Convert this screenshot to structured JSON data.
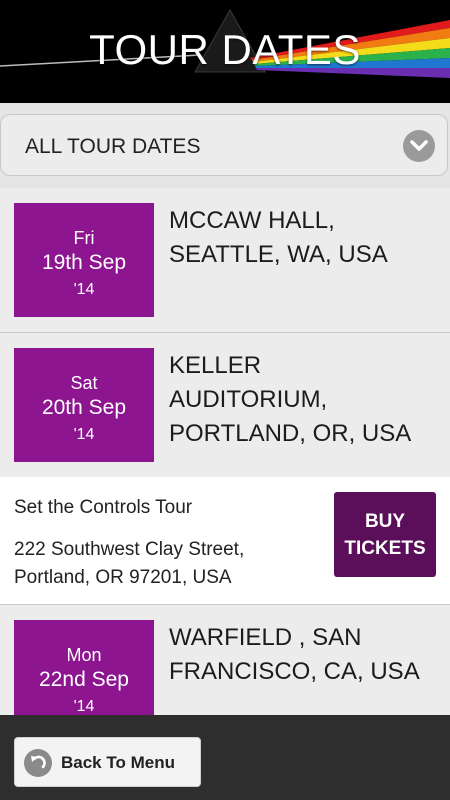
{
  "header": {
    "title": "TOUR DATES"
  },
  "filter": {
    "selected": "ALL TOUR DATES"
  },
  "events": [
    {
      "day": "Fri",
      "date": "19th Sep",
      "year": "'14",
      "venue": [
        "MCCAW HALL,",
        "SEATTLE, WA, USA"
      ]
    },
    {
      "day": "Sat",
      "date": "20th Sep",
      "year": "'14",
      "venue": [
        "KELLER",
        "AUDITORIUM,",
        "PORTLAND, OR, USA"
      ]
    },
    {
      "day": "Mon",
      "date": "22nd Sep",
      "year": "'14",
      "venue": [
        "WARFIELD , SAN",
        "FRANCISCO, CA, USA"
      ]
    }
  ],
  "details": {
    "tour_name": "Set the Controls Tour",
    "address_line1": "222 Southwest Clay Street,",
    "address_line2": "Portland, OR 97201, USA",
    "buy_line1": "BUY",
    "buy_line2": "TICKETS"
  },
  "footer": {
    "back_label": "Back To Menu"
  },
  "colors": {
    "date_box": "#8d1590",
    "buy_button": "#5b0f5b",
    "header_bg": "#000000"
  },
  "icons": {
    "filter": "chevron-down-icon",
    "back": "back-arrow-icon",
    "header_art": "prism-icon"
  }
}
